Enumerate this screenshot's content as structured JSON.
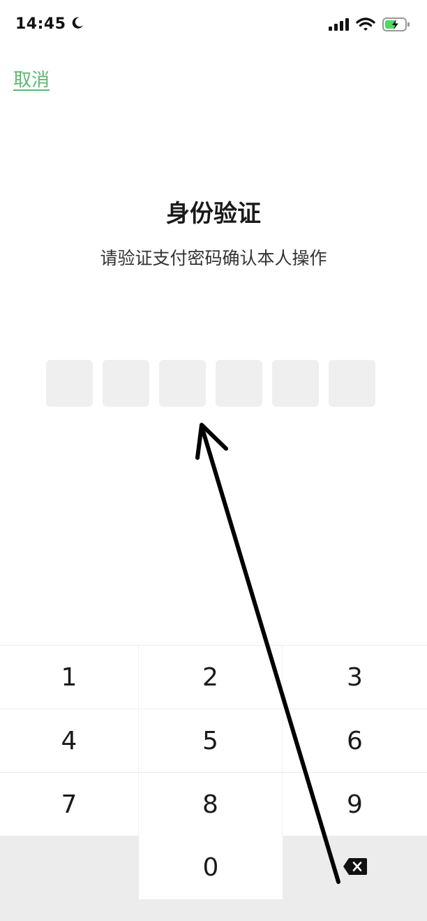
{
  "status_bar": {
    "time": "14:45",
    "icons": [
      "moon-icon",
      "cellular-signal-icon",
      "wifi-icon",
      "battery-charging-icon"
    ],
    "battery_color": "#4cd964"
  },
  "header": {
    "cancel_label": "取消",
    "accent_color": "#5bb870"
  },
  "main": {
    "title": "身份验证",
    "subtitle": "请验证支付密码确认本人操作",
    "pin_length": 6,
    "pin_filled": 0
  },
  "keypad": {
    "keys": [
      "1",
      "2",
      "3",
      "4",
      "5",
      "6",
      "7",
      "8",
      "9",
      "0"
    ],
    "delete_icon": "backspace-icon"
  },
  "annotation": {
    "icon": "arrow-annotation-icon"
  }
}
